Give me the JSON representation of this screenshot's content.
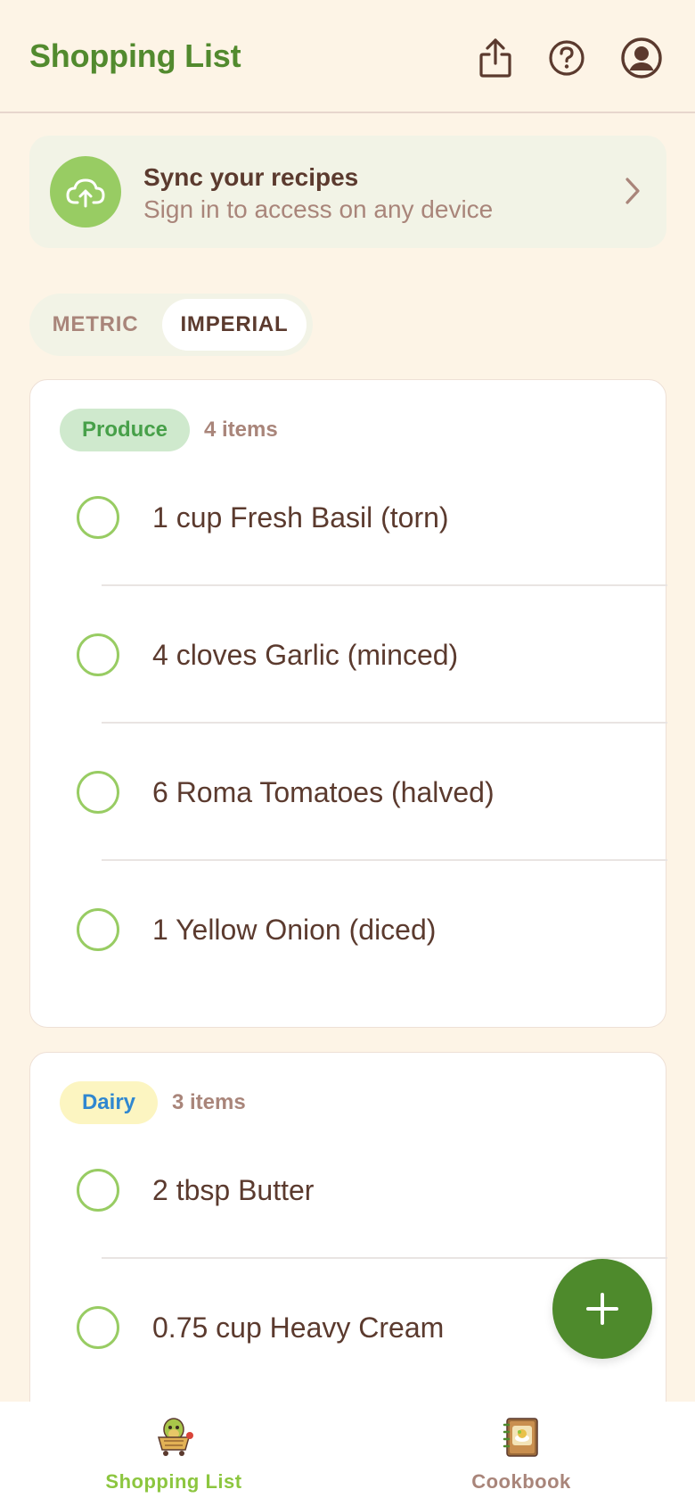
{
  "header": {
    "title": "Shopping List",
    "icons": [
      "share-icon",
      "help-icon",
      "account-icon"
    ]
  },
  "sync_banner": {
    "title": "Sync your recipes",
    "subtitle": "Sign in to access on any device",
    "icon": "cloud-upload-icon"
  },
  "units": {
    "options": [
      "METRIC",
      "IMPERIAL"
    ],
    "selected": "IMPERIAL"
  },
  "categories": [
    {
      "name": "Produce",
      "count_label": "4 items",
      "items": [
        "1 cup Fresh Basil (torn)",
        "4 cloves Garlic (minced)",
        "6 Roma Tomatoes (halved)",
        "1 Yellow Onion (diced)"
      ]
    },
    {
      "name": "Dairy",
      "count_label": "3 items",
      "items": [
        "2 tbsp Butter",
        "0.75 cup Heavy Cream"
      ]
    }
  ],
  "fab": {
    "icon": "plus-icon"
  },
  "bottom_nav": {
    "items": [
      {
        "label": "Shopping List",
        "icon": "shopping-cart-mascot-icon",
        "active": true
      },
      {
        "label": "Cookbook",
        "icon": "cookbook-icon",
        "active": false
      }
    ]
  },
  "colors": {
    "background": "#fdf4e6",
    "brand_green": "#528a2e",
    "accent_green": "#98cc63",
    "text_brown": "#5b3a2e",
    "muted_brown": "#a9857a",
    "fab_green": "#4e8a2c",
    "produce_badge_bg": "#cfe9cd",
    "dairy_badge_bg": "#fcf5c1",
    "dairy_badge_text": "#2f87d0"
  }
}
